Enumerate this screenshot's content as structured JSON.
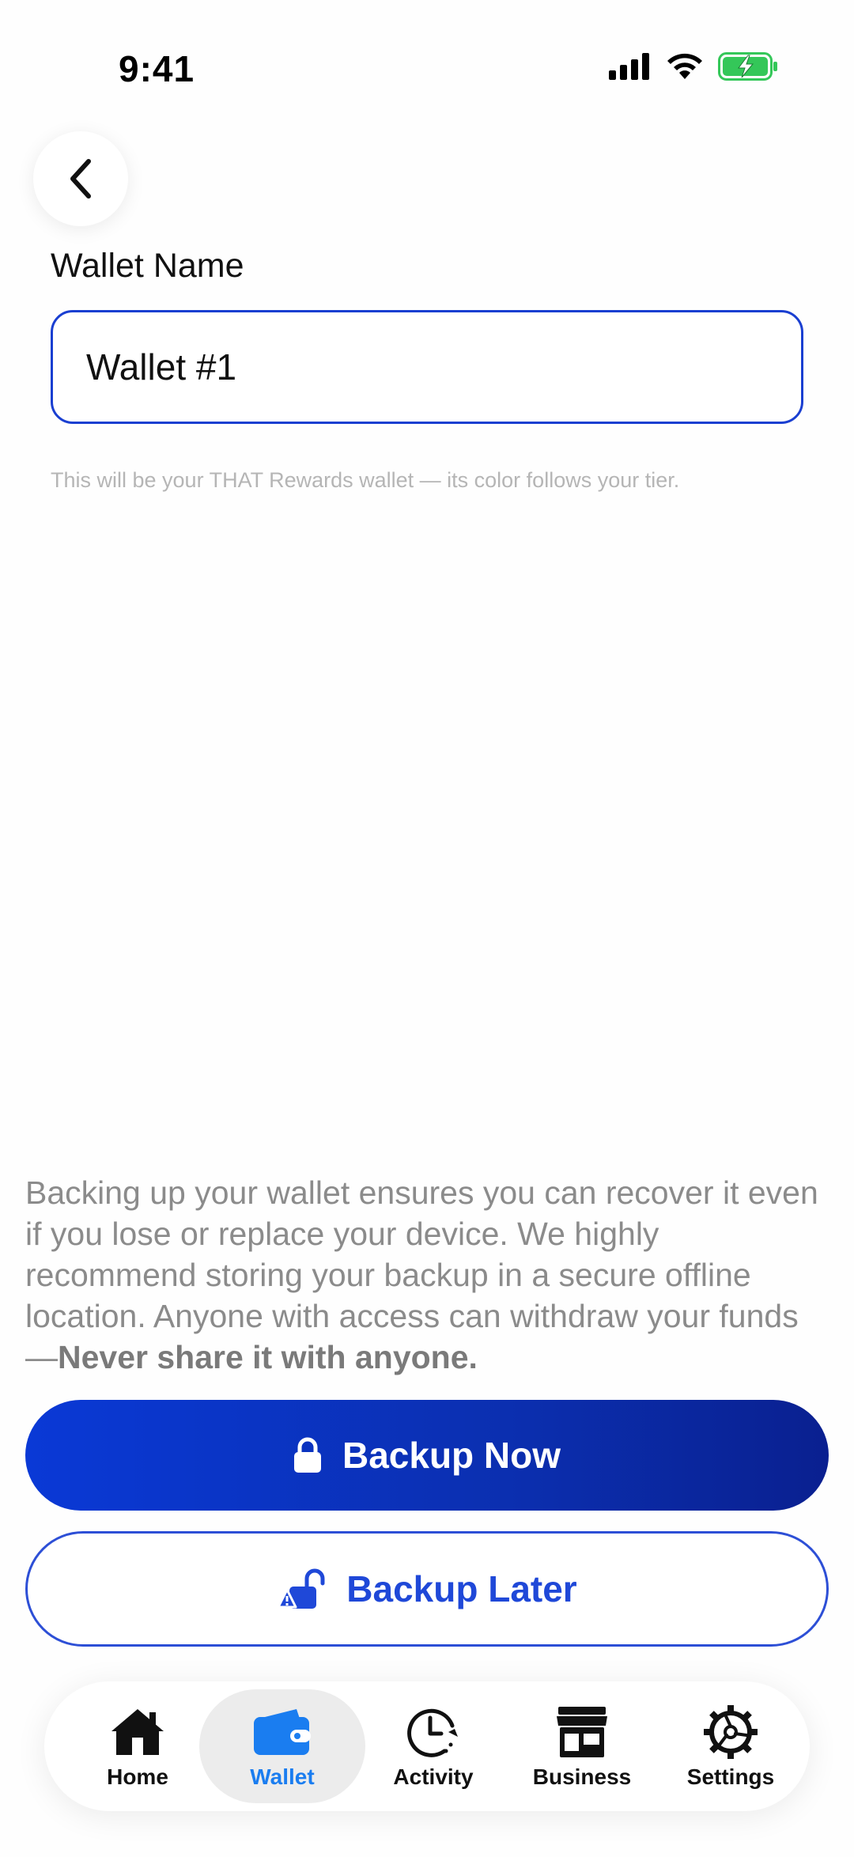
{
  "status": {
    "time": "9:41"
  },
  "form": {
    "label": "Wallet Name",
    "value": "Wallet #1",
    "helper": "This will be your THAT Rewards wallet — its color follows your tier."
  },
  "info": {
    "text": "Backing up your wallet ensures you can recover it even if you lose or replace your device. We highly recommend storing your backup in a secure offline location. Anyone with access can withdraw your funds—",
    "emphasis": "Never share it with anyone."
  },
  "buttons": {
    "backup_now": "Backup Now",
    "backup_later": "Backup Later"
  },
  "tabs": [
    {
      "label": "Home",
      "icon": "home-icon",
      "active": false
    },
    {
      "label": "Wallet",
      "icon": "wallet-icon",
      "active": true
    },
    {
      "label": "Activity",
      "icon": "clock-icon",
      "active": false
    },
    {
      "label": "Business",
      "icon": "store-icon",
      "active": false
    },
    {
      "label": "Settings",
      "icon": "gear-icon",
      "active": false
    }
  ],
  "colors": {
    "accent": "#1a3fd1",
    "tab_active": "#1a7df0",
    "battery": "#34c759"
  }
}
